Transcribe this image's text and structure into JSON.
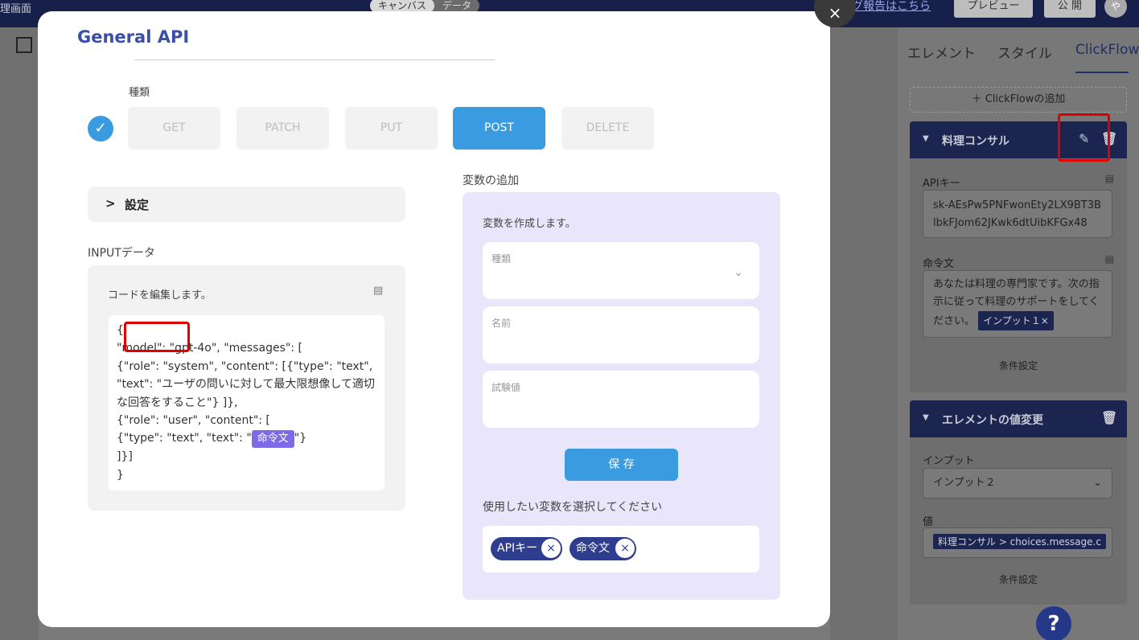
{
  "topbar": {
    "left_label": "理画面",
    "tabs": [
      "キャンバス",
      "データ"
    ],
    "bug_link": "バグ報告はこちら",
    "preview": "プレビュー",
    "publish": "公 開",
    "avatar": "や"
  },
  "modal": {
    "title": "General API",
    "type_label": "種類",
    "methods": [
      "GET",
      "PATCH",
      "PUT",
      "POST",
      "DELETE"
    ],
    "selected_method": "POST",
    "settings_label": "設定",
    "input_label": "INPUTデータ",
    "edit_label": "コードを編集します。",
    "code": {
      "l1": "{",
      "l2a": "\"model\": \"gpt-4o\", \"messages\": [",
      "l3": "{\"role\": \"system\", \"content\": [{\"type\": \"text\", \"text\": \"ユーザの問いに対して最大限想像して適切な回答をすること\"} ]},",
      "l4": "{\"role\": \"user\", \"content\": [",
      "l5a": "{\"type\": \"text\", \"text\": \"",
      "chip": "命令文",
      "l5b": "\"}",
      "l6": "]}]",
      "l7": "}"
    },
    "var_title": "変数の追加",
    "var_desc": "変数を作成します。",
    "fields": [
      "種類",
      "名前",
      "試験値"
    ],
    "save": "保 存",
    "select_label": "使用したい変数を選択してください",
    "chips": [
      "APIキー",
      "命令文"
    ]
  },
  "right_panel": {
    "tabs": [
      "エレメント",
      "スタイル",
      "ClickFlow"
    ],
    "active_tab": "ClickFlow",
    "add_flow": "ClickFlowの追加",
    "card1": {
      "title": "料理コンサル",
      "api_key_label": "APIキー",
      "api_key_value": "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",
      "prompt_label": "命令文",
      "prompt_value": "あなたは料理の専門家です。次の指示に従って料理のサポートをしてください。",
      "prompt_chip": "インプット１×",
      "condition": "条件設定"
    },
    "card2": {
      "title": "エレメントの値変更",
      "input_label": "インプット",
      "input_value": "インプット２",
      "value_label": "値",
      "value_chip": "料理コンサル > choices.message.c",
      "condition": "条件設定"
    }
  },
  "help": "?"
}
